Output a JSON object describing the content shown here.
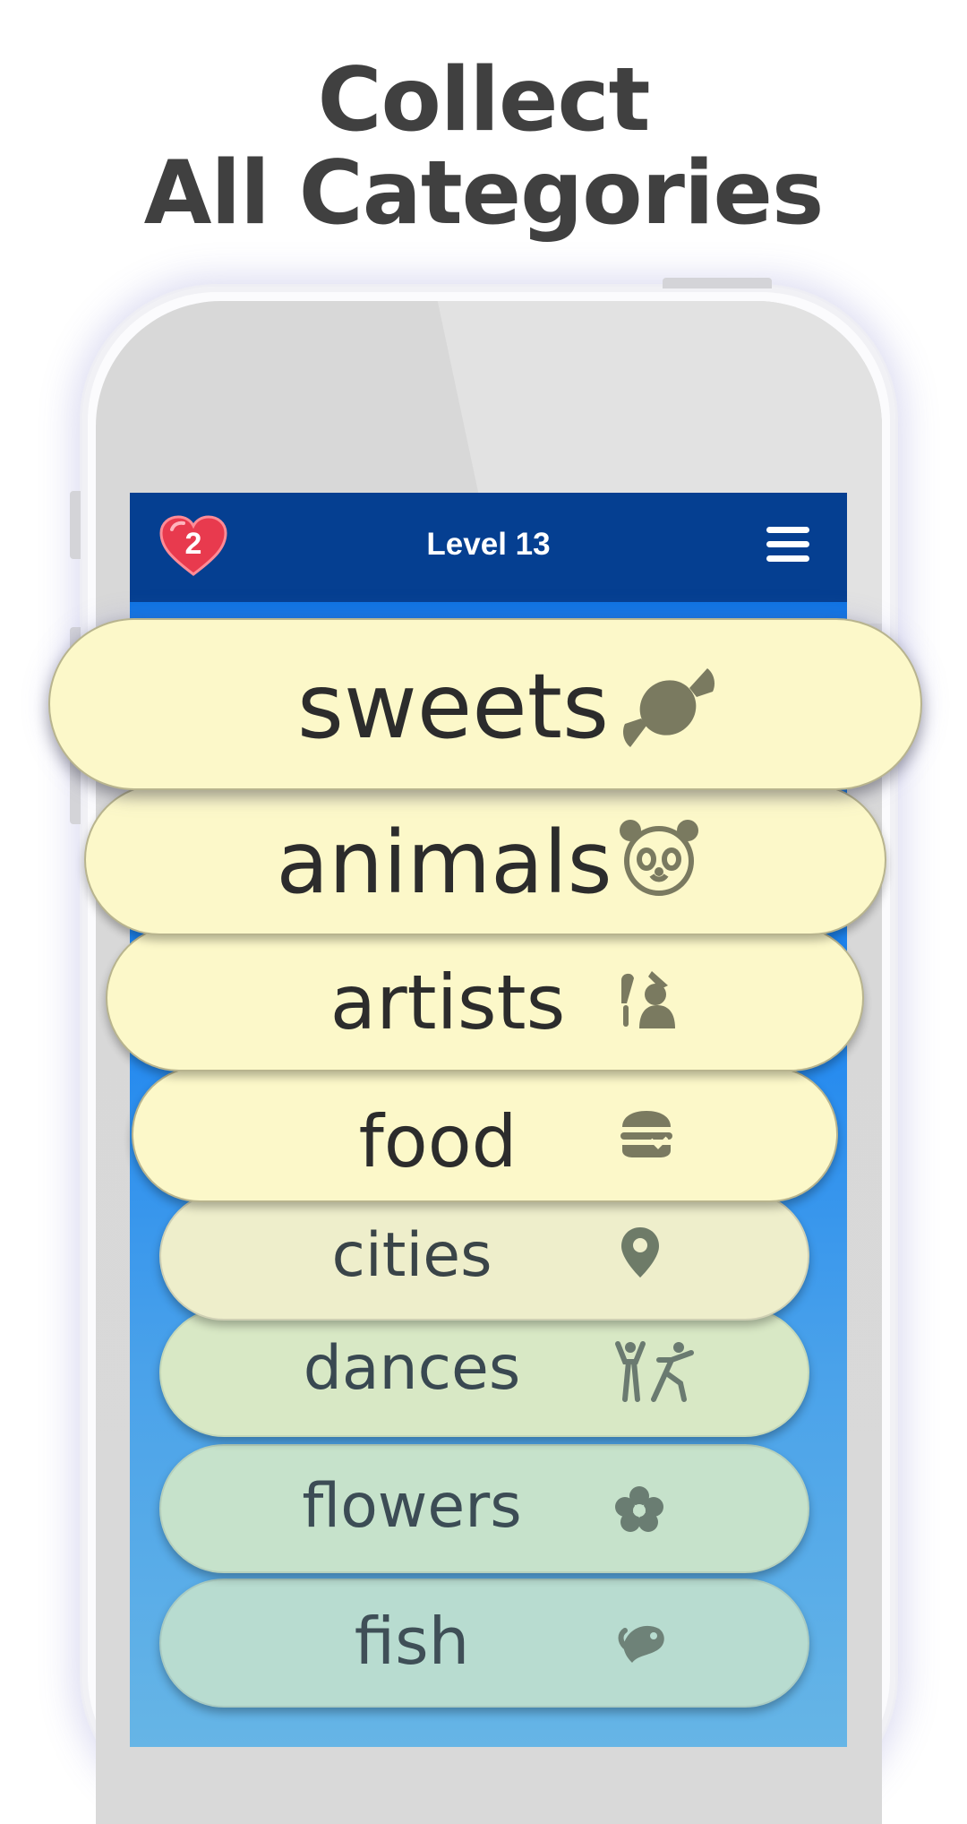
{
  "headline": {
    "line1": "Collect",
    "line2": "All Categories"
  },
  "game": {
    "lives": "2",
    "level_title": "Level 13"
  },
  "categories": [
    {
      "label": "sweets",
      "icon": "candy-icon"
    },
    {
      "label": "animals",
      "icon": "panda-icon"
    },
    {
      "label": "artists",
      "icon": "painter-icon"
    },
    {
      "label": "food",
      "icon": "burger-icon"
    },
    {
      "label": "cities",
      "icon": "map-pin-icon"
    },
    {
      "label": "dances",
      "icon": "dancers-icon"
    },
    {
      "label": "flowers",
      "icon": "flower-icon"
    },
    {
      "label": "fish",
      "icon": "fish-icon"
    }
  ],
  "colors": {
    "headline": "#404040",
    "top_bar": "#053f91",
    "pill": "#fcf8c9",
    "icon": "#7a7a60"
  }
}
